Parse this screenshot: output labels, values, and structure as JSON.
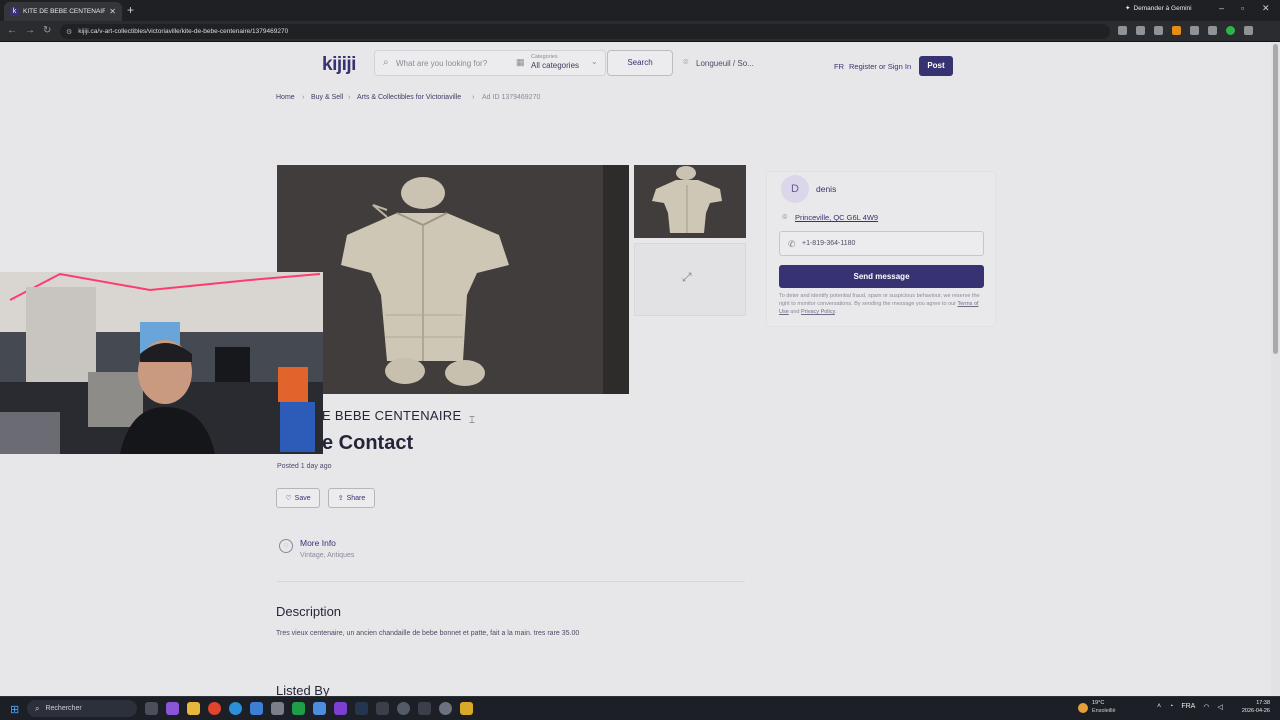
{
  "browser": {
    "tab_title": "KITE DE BEBE CENTENAIRE | A...",
    "gemini_label": "Demander à Gemini",
    "url": "kijiji.ca/v-art-collectibles/victoriaville/kite-de-bebe-centenaire/1379469270"
  },
  "header": {
    "logo": "kijiji",
    "search_placeholder": "What are you looking for?",
    "category_label": "Categories",
    "category_value": "All categories",
    "search_button": "Search",
    "location": "Longueuil / So...",
    "language": "FR",
    "register": "Register or Sign In",
    "post": "Post"
  },
  "breadcrumb": {
    "home": "Home",
    "buy_sell": "Buy & Sell",
    "category": "Arts & Collectibles for Victoriaville",
    "ad_id": "Ad ID 1379469270"
  },
  "seller": {
    "avatar_letter": "D",
    "name": "denis",
    "location": "Princeville, QC G6L 4W9",
    "phone": "+1-819-364-1180",
    "send_message": "Send message",
    "disclaimer_1": "To deter and identify potential fraud, spam or suspicious behaviour, we reserve the right to monitor conversations. By sending the message you agree to our ",
    "terms": "Terms of Use",
    "and": " and ",
    "privacy": "Privacy Policy",
    "period": "."
  },
  "listing": {
    "title_line1": "E BEBE CENTENAIRE",
    "title_line2": "e Contact",
    "posted": "Posted 1 day ago",
    "save": "Save",
    "share": "Share",
    "more_info_title": "More Info",
    "more_info_sub": "Vintage, Antiques",
    "description_heading": "Description",
    "description_text": "Tres vieux centenaire, un ancien chandaille de bebe bonnet et patte, fait a la main. tres rare 35.00",
    "listed_by": "Listed By"
  },
  "taskbar": {
    "search_label": "Rechercher",
    "weather_temp": "19°C",
    "weather_desc": "Ensoleillé",
    "lang": "FRA",
    "time": "17:38",
    "date": "2026-04-26"
  }
}
